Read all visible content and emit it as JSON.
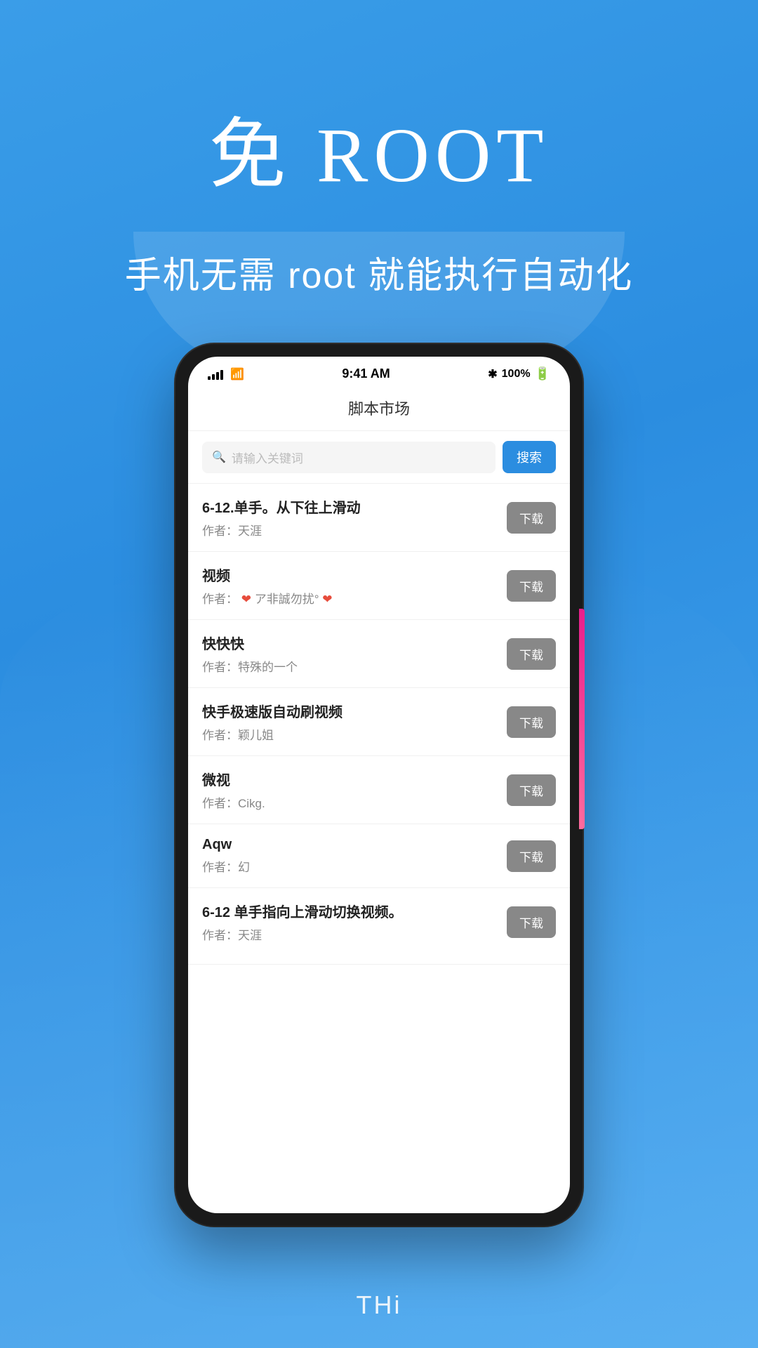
{
  "hero": {
    "title": "免 ROOT",
    "subtitle": "手机无需 root 就能执行自动化"
  },
  "status_bar": {
    "time": "9:41 AM",
    "battery": "100%",
    "bluetooth": "✱"
  },
  "app_header": {
    "title": "脚本市场"
  },
  "search": {
    "placeholder": "请输入关键词",
    "button_label": "搜索"
  },
  "scripts": [
    {
      "name": "6-12.单手。从下往上滑动",
      "author": "作者：天涯",
      "download_label": "下载"
    },
    {
      "name": "视频",
      "author_prefix": "作者：",
      "author_text": "❤ ︎ア非誠勿扰°❤",
      "download_label": "下载"
    },
    {
      "name": "快快快",
      "author": "作者：特殊的一个",
      "download_label": "下载"
    },
    {
      "name": "快手极速版自动刷视频",
      "author": "作者：颖儿姐",
      "download_label": "下载"
    },
    {
      "name": "微视",
      "author": "作者：Cikg.",
      "download_label": "下载"
    },
    {
      "name": "Aqw",
      "author": "作者：幻",
      "download_label": "下载"
    },
    {
      "name": "6-12 单手指向上滑动切换视频。",
      "author": "作者：天涯",
      "download_label": "下载"
    }
  ],
  "bottom_label": "THi"
}
